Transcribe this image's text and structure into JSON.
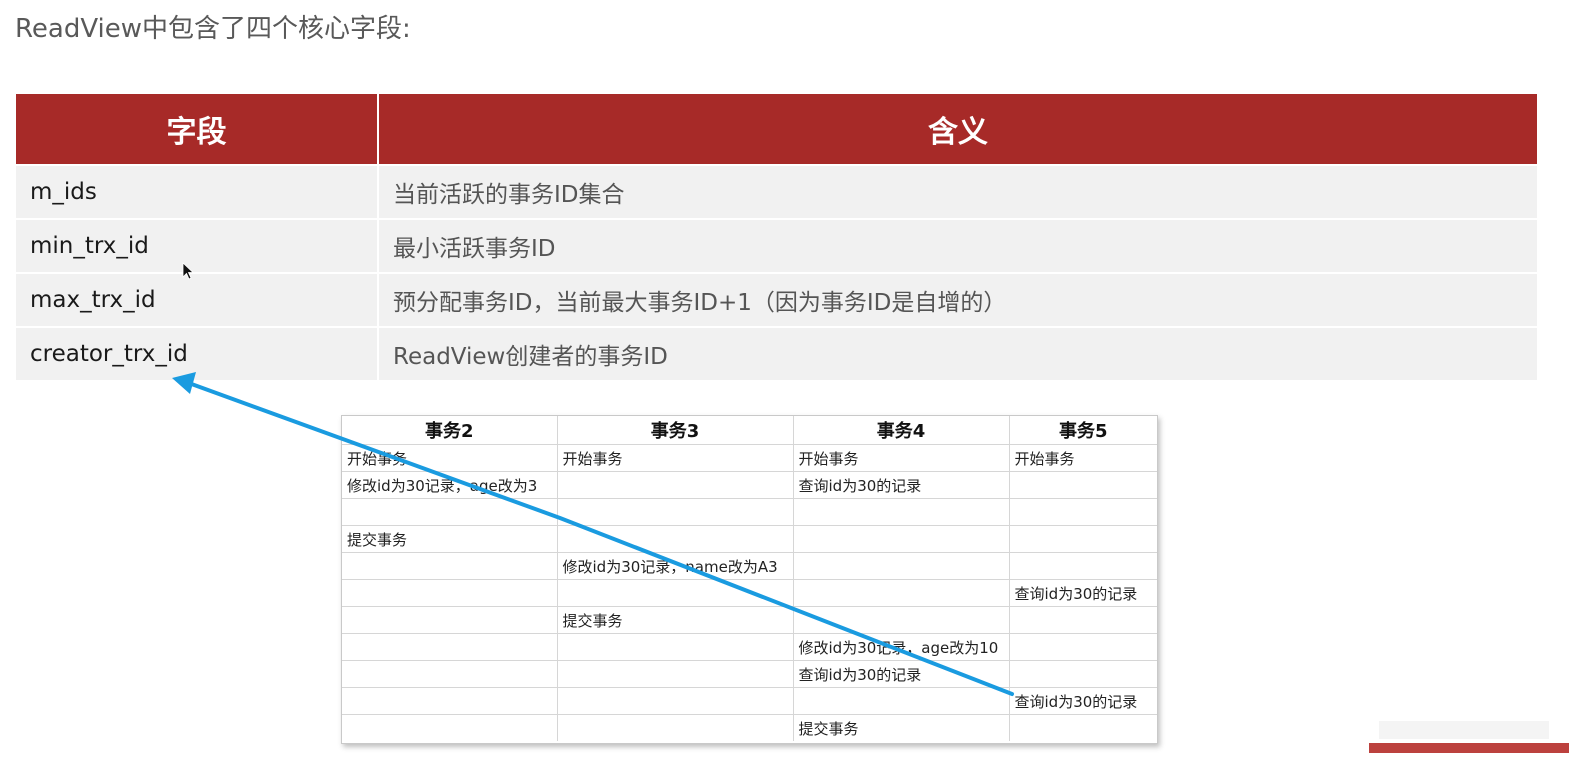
{
  "heading": "ReadView中包含了四个核心字段:",
  "readview_table": {
    "headers": [
      "字段",
      "含义"
    ],
    "rows": [
      {
        "field": "m_ids",
        "meaning": "当前活跃的事务ID集合"
      },
      {
        "field": "min_trx_id",
        "meaning": "最小活跃事务ID"
      },
      {
        "field": "max_trx_id",
        "meaning": "预分配事务ID，当前最大事务ID+1（因为事务ID是自增的）"
      },
      {
        "field": "creator_trx_id",
        "meaning": "ReadView创建者的事务ID"
      }
    ]
  },
  "tx_table": {
    "headers": [
      "事务2",
      "事务3",
      "事务4",
      "事务5"
    ],
    "rows": [
      [
        "开始事务",
        "开始事务",
        "开始事务",
        "开始事务"
      ],
      [
        "修改id为30记录，age改为3",
        "",
        "查询id为30的记录",
        ""
      ],
      [
        "",
        "",
        "",
        ""
      ],
      [
        "提交事务",
        "",
        "",
        ""
      ],
      [
        "",
        "修改id为30记录，name改为A3",
        "",
        ""
      ],
      [
        "",
        "",
        "",
        "查询id为30的记录"
      ],
      [
        "",
        "提交事务",
        "",
        ""
      ],
      [
        "",
        "",
        "修改id为30记录，age改为10",
        ""
      ],
      [
        "",
        "",
        "查询id为30的记录",
        ""
      ],
      [
        "",
        "",
        "",
        "查询id为30的记录"
      ],
      [
        "",
        "",
        "提交事务",
        ""
      ]
    ]
  },
  "icons": {
    "annotation": "arrow-annotation",
    "pointer": "mouse-cursor-icon",
    "corner": "watermark-logo"
  },
  "colors": {
    "header_bg": "#a72a28",
    "row_bg": "#f1f1f1",
    "arrow": "#1a9be0"
  }
}
